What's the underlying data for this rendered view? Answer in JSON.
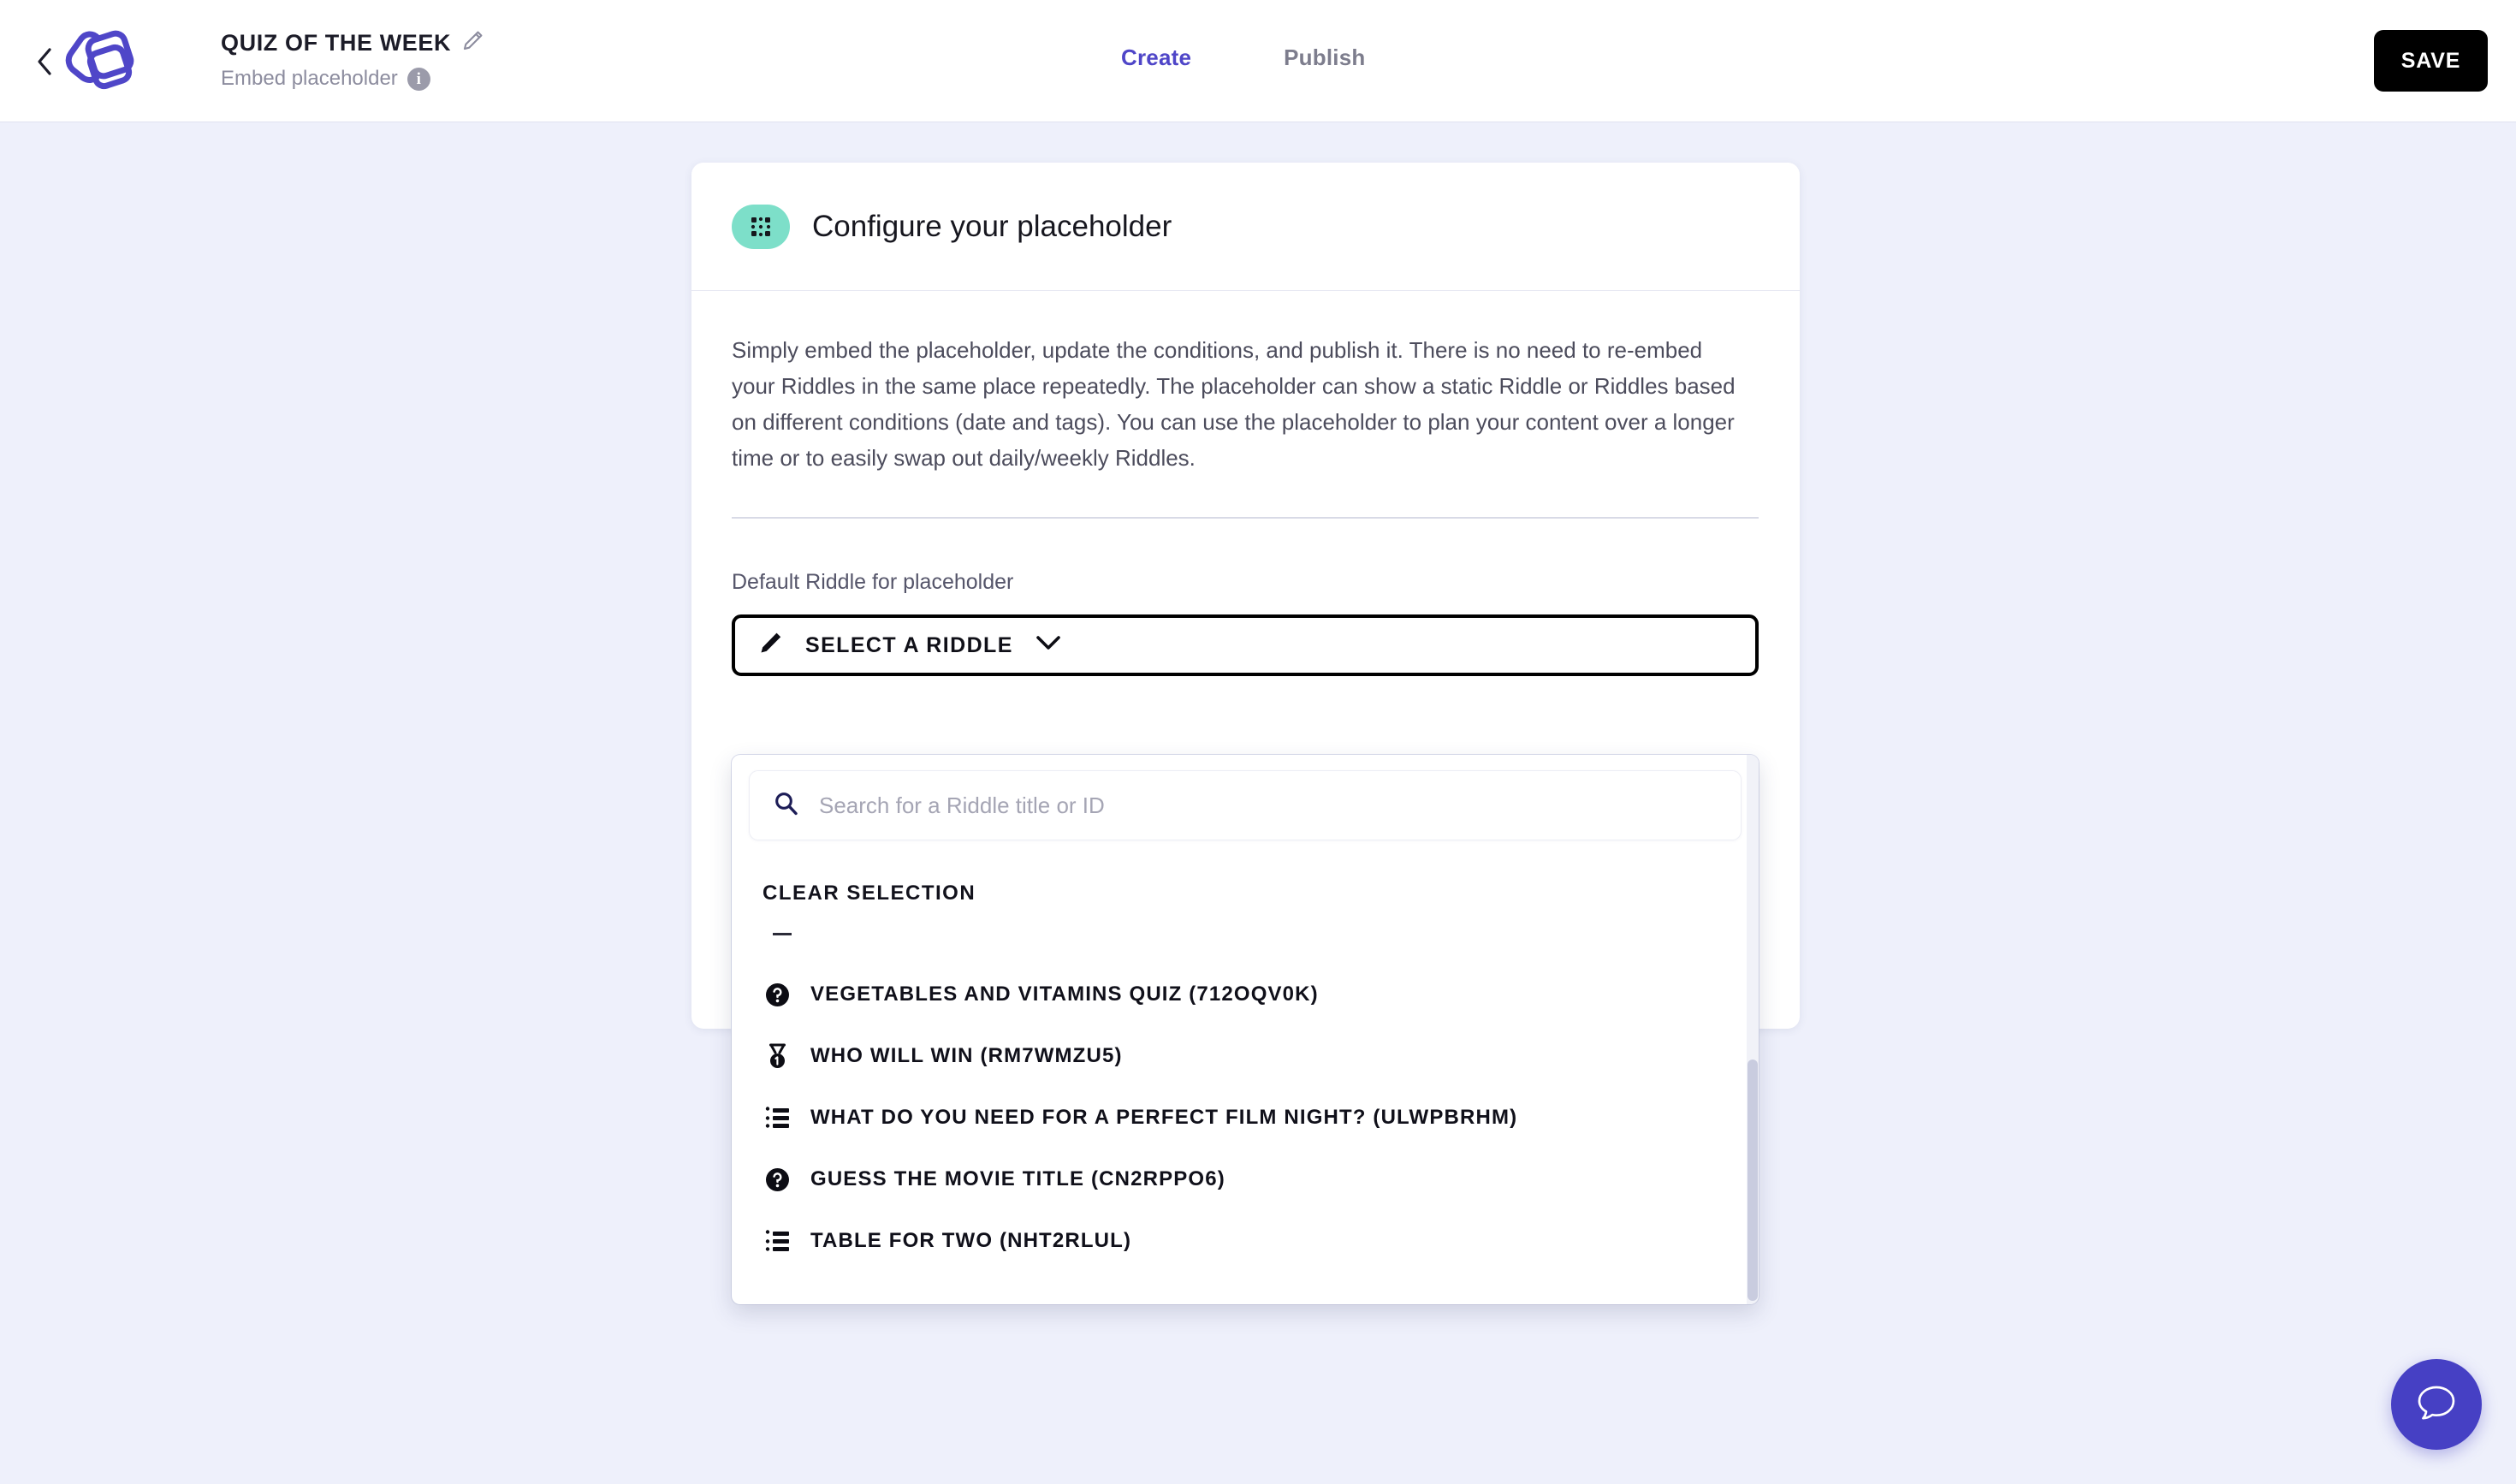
{
  "header": {
    "back_icon": "chevron-left-icon",
    "logo_icon": "riddle-logo-icon",
    "quiz_title": "QUIZ OF THE WEEK",
    "edit_icon": "pencil-icon",
    "subtitle": "Embed placeholder",
    "info_icon": "info-icon",
    "tabs": [
      {
        "label": "Create",
        "active": true
      },
      {
        "label": "Publish",
        "active": false
      }
    ],
    "save_label": "SAVE"
  },
  "card": {
    "badge_icon": "dotted-grid-icon",
    "badge_color": "#7ddfc9",
    "title": "Configure your placeholder",
    "intro": "Simply embed the placeholder, update the conditions, and publish it. There is no need to re-embed your Riddles in the same place repeatedly. The placeholder can show a static Riddle or Riddles based on different conditions (date and tags). You can use the placeholder to plan your content over a longer time or to easily swap out daily/weekly Riddles.",
    "field_label": "Default Riddle for placeholder",
    "select_icon": "pencil-icon",
    "select_label": "SELECT A RIDDLE",
    "chevron_icon": "chevron-down-icon"
  },
  "dropdown": {
    "search_icon": "search-icon",
    "search_value": "",
    "search_placeholder": "Search for a Riddle title or ID",
    "clear_heading": "CLEAR SELECTION",
    "clear_value": "—",
    "items": [
      {
        "icon": "question-circle-icon",
        "label": "VEGETABLES AND VITAMINS QUIZ (712OQV0K)"
      },
      {
        "icon": "medal-icon",
        "label": "WHO WILL WIN (RM7WMZU5)"
      },
      {
        "icon": "list-icon",
        "label": "WHAT DO YOU NEED FOR A PERFECT FILM NIGHT? (ULWPBRHM)"
      },
      {
        "icon": "question-circle-icon",
        "label": "GUESS THE MOVIE TITLE (CN2RPPO6)"
      },
      {
        "icon": "list-icon",
        "label": "TABLE FOR TWO (NHT2RLUL)"
      }
    ]
  },
  "chat": {
    "icon": "chat-bubble-icon"
  },
  "colors": {
    "page_background": "#eef0fb",
    "accent_indigo": "#4f46c8",
    "badge_teal": "#7ddfc9",
    "save_black": "#000000",
    "chat_purple": "#4640c4"
  }
}
